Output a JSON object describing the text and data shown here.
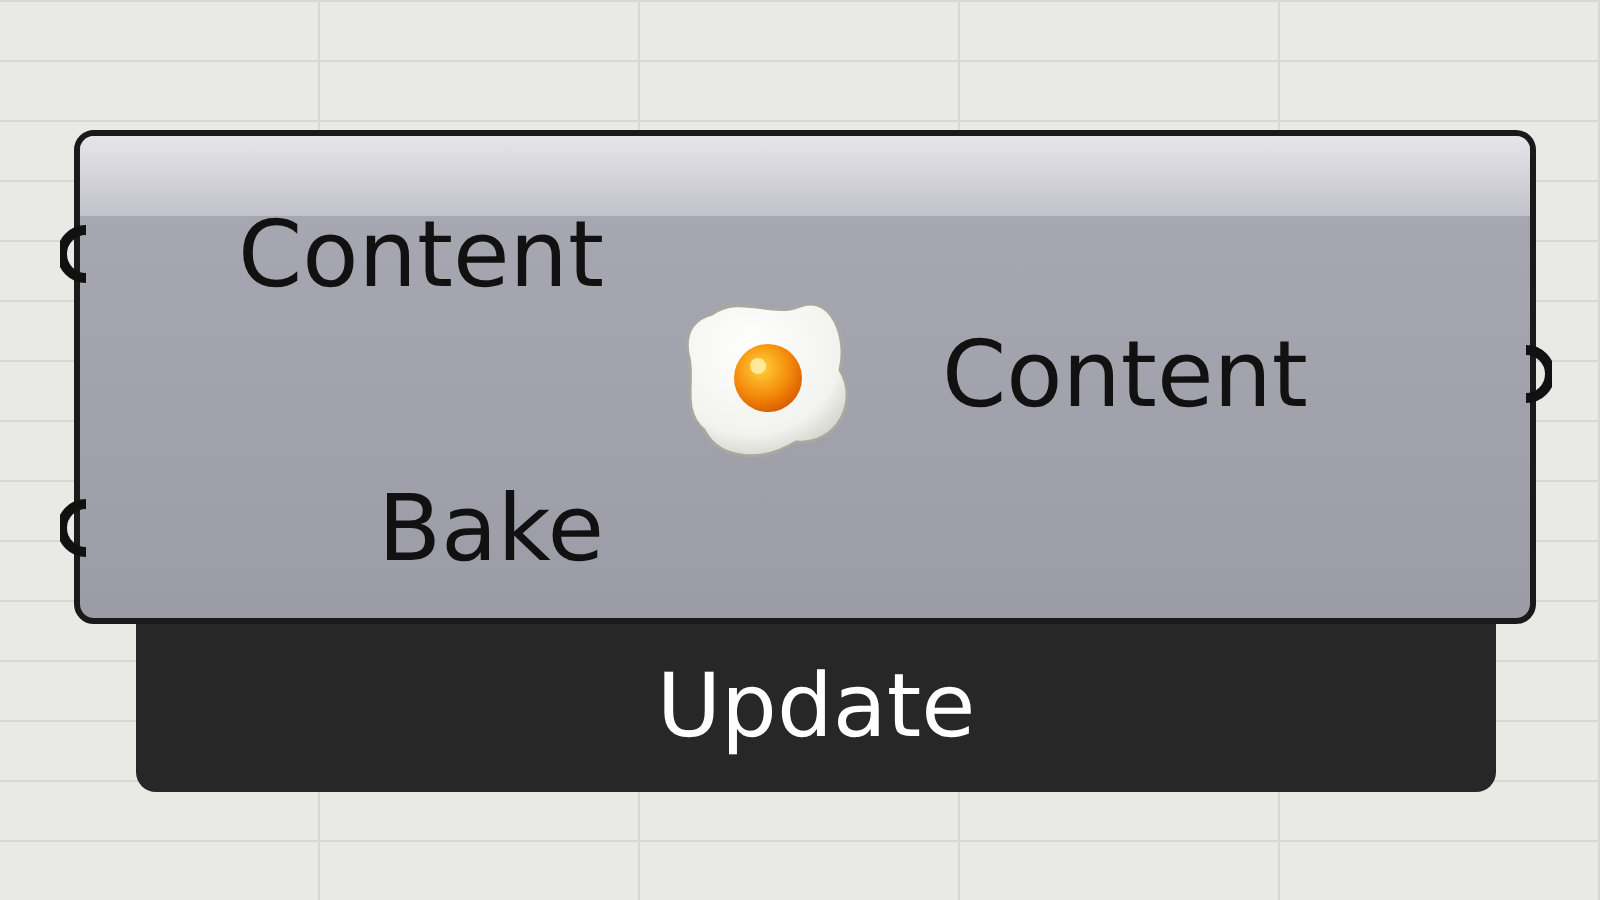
{
  "component": {
    "inputs": [
      {
        "label": "Content"
      },
      {
        "label": "Bake"
      }
    ],
    "outputs": [
      {
        "label": "Content"
      }
    ],
    "message": "Update"
  }
}
